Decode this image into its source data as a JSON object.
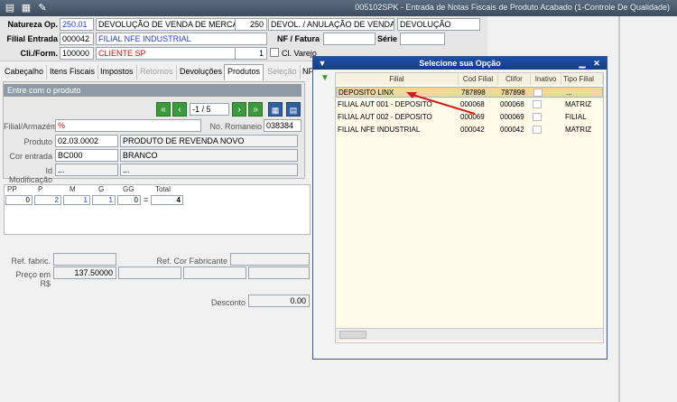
{
  "window": {
    "title": "005102SPK - Entrada de Notas Fiscais de Produto Acabado (1-Controle De Qualidade)"
  },
  "toolbar_icons": [
    "clipboard-icon",
    "filmstrip-icon",
    "wrench-icon"
  ],
  "header": {
    "natureza_label": "Natureza Op.",
    "natureza_code": "250.01",
    "natureza_desc": "DEVOLUÇÃO DE VENDA DE MERCADORIA",
    "natureza_num": "250",
    "natureza_desc2": "DEVOL. / ANULAÇÃO DE VENDA",
    "natureza_type": "DEVOLUÇÃO",
    "filial_label": "Filial Entrada",
    "filial_code": "000042",
    "filial_name": "FILIAL NFE INDUSTRIAL",
    "nf_label": "NF / Fatura",
    "nf_value": "",
    "serie_label": "Série",
    "serie_value": "",
    "cli_label": "Cli./Form.",
    "cli_code": "100000",
    "cli_name": "CLIENTE SP",
    "cli_num": "1",
    "varejo_label": "Cl. Varejo"
  },
  "tabs": [
    {
      "label": "Cabeçalho",
      "state": "normal"
    },
    {
      "label": "Itens Fiscais",
      "state": "normal"
    },
    {
      "label": "Impostos",
      "state": "normal"
    },
    {
      "label": "Retornos",
      "state": "dim"
    },
    {
      "label": "Devoluções",
      "state": "normal"
    },
    {
      "label": "Produtos",
      "state": "active"
    },
    {
      "label": "Seleção",
      "state": "dim"
    },
    {
      "label": "NF",
      "state": "normal"
    }
  ],
  "produto_panel": {
    "title": "Entre com o produto",
    "record_counter": "-1 / 5",
    "filial_label": "Filial/Armazém",
    "filial_value": "%",
    "romaneio_label": "No. Romaneio",
    "romaneio_value": "038384",
    "produto_label": "Produto",
    "produto_code": "02.03.0002",
    "produto_desc": "PRODUTO DE REVENDA NOVO",
    "cor_label": "Cor entrada",
    "cor_code": "BC000",
    "cor_desc": "BRANCO",
    "idmod_label": "Id Modificação",
    "idmod_code": "...",
    "idmod_desc": "..."
  },
  "size_grid": {
    "headers": [
      "PP",
      "P",
      "M",
      "G",
      "GG",
      "Total"
    ],
    "values": [
      "0",
      "2",
      "1",
      "1",
      "0",
      "4"
    ],
    "equals": "="
  },
  "details": {
    "ref_fabric_label": "Ref. fabric.",
    "ref_cor_label": "Ref. Cor Fabricante",
    "preco_label": "Preço em R$",
    "preco_value": "137.50000",
    "desconto_label": "Desconto",
    "desconto_value": "0.00"
  },
  "dialog": {
    "title": "Selecione sua Opção",
    "columns": [
      "Filial",
      "Cod Filial",
      "Clifor",
      "Inativo",
      "Tipo Filial"
    ],
    "rows": [
      {
        "filial": "DEPOSITO LINX",
        "cod": "787898",
        "clifor": "787898",
        "tipo": "..."
      },
      {
        "filial": "FILIAL AUT 001 - DEPOSITO",
        "cod": "000068",
        "clifor": "000068",
        "tipo": "MATRIZ"
      },
      {
        "filial": "FILIAL AUT 002 - DEPOSITO",
        "cod": "000069",
        "clifor": "000069",
        "tipo": "FILIAL"
      },
      {
        "filial": "FILIAL NFE INDUSTRIAL",
        "cod": "000042",
        "clifor": "000042",
        "tipo": "MATRIZ"
      }
    ]
  },
  "colors": {
    "accent": "#1e4fa8",
    "selected_row": "#f3d69a",
    "arrow": "#d81818"
  }
}
